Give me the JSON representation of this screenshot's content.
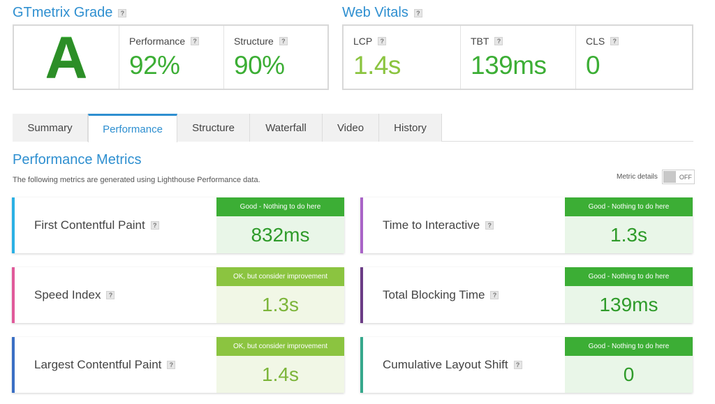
{
  "grade": {
    "title": "GTmetrix Grade",
    "letter": "A",
    "performance_label": "Performance",
    "performance_value": "92%",
    "structure_label": "Structure",
    "structure_value": "90%"
  },
  "vitals": {
    "title": "Web Vitals",
    "lcp_label": "LCP",
    "lcp_value": "1.4s",
    "tbt_label": "TBT",
    "tbt_value": "139ms",
    "cls_label": "CLS",
    "cls_value": "0"
  },
  "help_mark": "?",
  "tabs": [
    "Summary",
    "Performance",
    "Structure",
    "Waterfall",
    "Video",
    "History"
  ],
  "active_tab": "Performance",
  "metrics_section": {
    "title": "Performance Metrics",
    "subtitle": "The following metrics are generated using Lighthouse Performance data.",
    "details_label": "Metric details",
    "toggle_state": "OFF"
  },
  "metrics": [
    {
      "name": "First Contentful Paint",
      "badge": "Good - Nothing to do here",
      "value": "832ms",
      "status": "good",
      "color": "#2bb0e4"
    },
    {
      "name": "Time to Interactive",
      "badge": "Good - Nothing to do here",
      "value": "1.3s",
      "status": "good",
      "color": "#a964c7"
    },
    {
      "name": "Speed Index",
      "badge": "OK, but consider improvement",
      "value": "1.3s",
      "status": "ok",
      "color": "#e05a9a"
    },
    {
      "name": "Total Blocking Time",
      "badge": "Good - Nothing to do here",
      "value": "139ms",
      "status": "good",
      "color": "#6b3c86"
    },
    {
      "name": "Largest Contentful Paint",
      "badge": "OK, but consider improvement",
      "value": "1.4s",
      "status": "ok",
      "color": "#3a6fc4"
    },
    {
      "name": "Cumulative Layout Shift",
      "badge": "Good - Nothing to do here",
      "value": "0",
      "status": "good",
      "color": "#36a88c"
    }
  ],
  "colors": {
    "accent": "#2e8fd0",
    "good": "#3cae35",
    "ok": "#8bc440"
  }
}
